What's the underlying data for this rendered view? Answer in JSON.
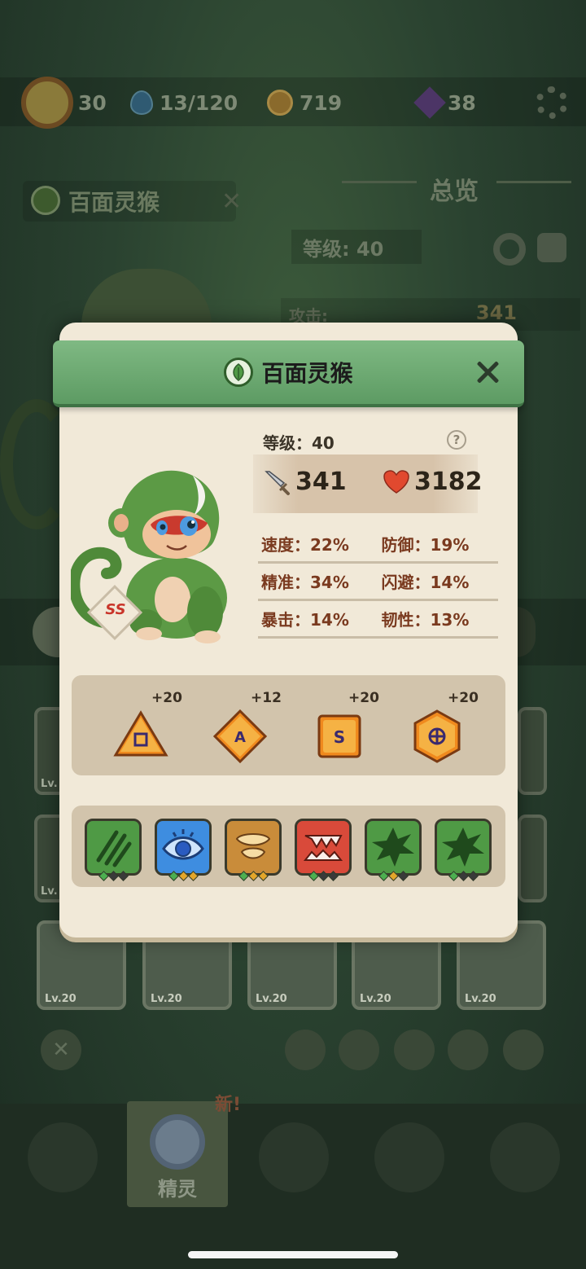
{
  "background": {
    "hud": {
      "level": "30",
      "water": "13/120",
      "coins": "719",
      "gems": "38"
    },
    "monster_name": "百面灵猴",
    "overview_label": "总览",
    "level_label": "等级: 40",
    "attack_label": "攻击:",
    "attack_value": "341",
    "new_tag": "新!",
    "nav_active_label": "精灵",
    "cards": [
      "Lv.20",
      "Lv.20",
      "Lv.20",
      "Lv.20",
      "Lv.20"
    ],
    "side_card_lv": [
      "Lv.",
      "Lv.",
      "Lv."
    ]
  },
  "dialog": {
    "title": "百面灵猴",
    "level": "等级：40",
    "help": "?",
    "attack": "341",
    "hp": "3182",
    "stats": [
      {
        "left": "速度：22%",
        "right": "防御：19%"
      },
      {
        "left": "精准：34%",
        "right": "闪避：14%"
      },
      {
        "left": "暴击：14%",
        "right": "韧性：13%"
      }
    ],
    "rank": "SS",
    "runes": [
      {
        "bonus": "+20",
        "letter": "",
        "shape": "triangle"
      },
      {
        "bonus": "+12",
        "letter": "A",
        "shape": "diamond"
      },
      {
        "bonus": "+20",
        "letter": "S",
        "shape": "square"
      },
      {
        "bonus": "+20",
        "letter": "",
        "shape": "hexagon"
      }
    ],
    "skills": [
      {
        "icon": "claw-slash-icon",
        "color": "#4f9a45",
        "dots": [
          "#4caf50",
          "#3a3a3a",
          "#3a3a3a"
        ]
      },
      {
        "icon": "eye-icon",
        "color": "#3e8de0",
        "dots": [
          "#4caf50",
          "#e3a62a",
          "#e3a62a"
        ]
      },
      {
        "icon": "bowl-icon",
        "color": "#c98c3a",
        "dots": [
          "#4caf50",
          "#e3a62a",
          "#e3a62a"
        ]
      },
      {
        "icon": "fangs-icon",
        "color": "#d94a3a",
        "dots": [
          "#4caf50",
          "#3a3a3a",
          "#3a3a3a"
        ]
      },
      {
        "icon": "spiked-blob-icon",
        "color": "#4f9a45",
        "dots": [
          "#4caf50",
          "#e3a62a",
          "#3a3a3a"
        ]
      },
      {
        "icon": "spiked-blob-icon",
        "color": "#4f9a45",
        "dots": [
          "#4caf50",
          "#3a3a3a",
          "#3a3a3a"
        ]
      }
    ]
  },
  "colors": {
    "header_green": "#6aa86f",
    "dialog_bg": "#f1e9d8",
    "stat_text": "#7a3a1f",
    "rune_orange": "#f08a1e"
  }
}
